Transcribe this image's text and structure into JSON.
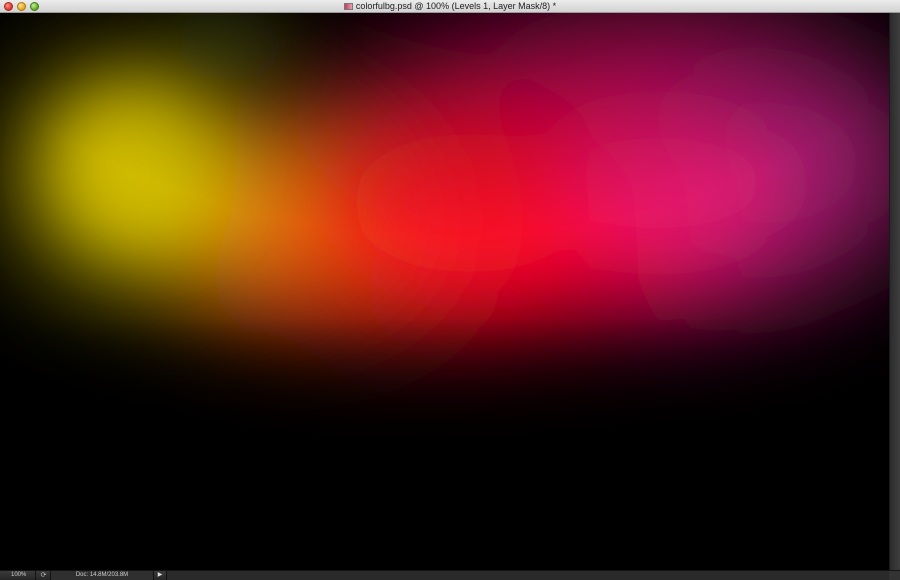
{
  "window": {
    "title": "colorfulbg.psd @ 100% (Levels 1, Layer Mask/8) *",
    "document_icon": "psd-document-icon",
    "buttons": [
      "close",
      "minimize",
      "zoom"
    ]
  },
  "canvas": {
    "content": "blurred colorful gradient",
    "colors": {
      "background": "#000000",
      "yellow": "#c8b400",
      "orange": "#e8640a",
      "red": "#f00028",
      "magenta": "#e6147a",
      "purple": "#8a2a6a"
    }
  },
  "status_bar": {
    "zoom": "100%",
    "doc_size": "Doc: 14.8M/203.8M",
    "arrow_icon": "play-right-icon",
    "refresh_icon": "rotate-icon"
  }
}
